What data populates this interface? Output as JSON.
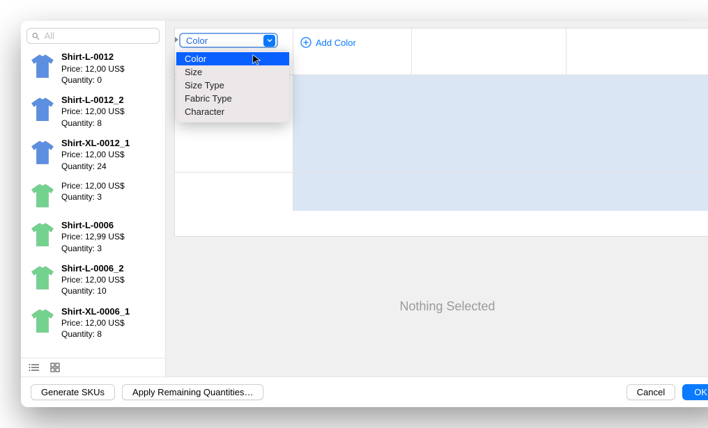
{
  "search": {
    "placeholder": "All"
  },
  "products": [
    {
      "name": "Shirt-L-0012",
      "price": "Price: 12,00 US$",
      "qty": "Quantity: 0",
      "color": "#5c8fe0"
    },
    {
      "name": "Shirt-L-0012_2",
      "price": "Price: 12,00 US$",
      "qty": "Quantity: 8",
      "color": "#5c8fe0"
    },
    {
      "name": "Shirt-XL-0012_1",
      "price": "Price: 12,00 US$",
      "qty": "Quantity: 24",
      "color": "#5c8fe0"
    },
    {
      "name": "",
      "price": "Price: 12,00 US$",
      "qty": "Quantity: 3",
      "color": "#74d28f"
    },
    {
      "name": "Shirt-L-0006",
      "price": "Price: 12,99 US$",
      "qty": "Quantity: 3",
      "color": "#74d28f"
    },
    {
      "name": "Shirt-L-0006_2",
      "price": "Price: 12,00 US$",
      "qty": "Quantity: 10",
      "color": "#74d28f"
    },
    {
      "name": "Shirt-XL-0006_1",
      "price": "Price: 12,00 US$",
      "qty": "Quantity: 8",
      "color": "#74d28f"
    }
  ],
  "dropdown": {
    "selected": "Color",
    "options": [
      "Color",
      "Size",
      "Size Type",
      "Fabric Type",
      "Character"
    ]
  },
  "addColor": "Add Color",
  "nothing": "Nothing Selected",
  "buttons": {
    "generate": "Generate SKUs",
    "apply": "Apply Remaining Quantities…",
    "cancel": "Cancel",
    "ok": "OK"
  }
}
